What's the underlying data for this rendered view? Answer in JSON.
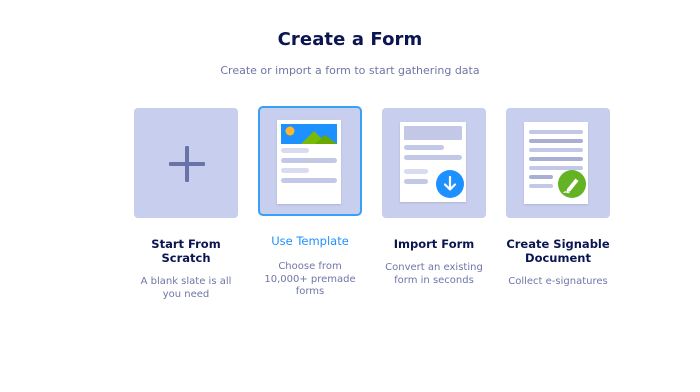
{
  "header": {
    "title": "Create a Form",
    "subtitle": "Create or import a form to start gathering data"
  },
  "options": [
    {
      "label": "Start From Scratch",
      "label_line1": "Start From",
      "label_line2": "Scratch",
      "desc_line1": "A blank slate is all",
      "desc_line2": "you need",
      "icon": "plus-icon"
    },
    {
      "label": "Use Template",
      "desc_line1": "Choose from",
      "desc_line2": "10,000+ premade",
      "desc_line3": "forms",
      "icon": "template-icon",
      "selected": true
    },
    {
      "label": "Import Form",
      "desc_line1": "Convert an existing",
      "desc_line2": "form in seconds",
      "icon": "import-icon"
    },
    {
      "label": "Create Signable Document",
      "label_line1": "Create Signable",
      "label_line2": "Document",
      "desc_line1": "Collect e-signatures",
      "icon": "signature-icon"
    }
  ],
  "colors": {
    "title": "#0a1551",
    "muted": "#6f76a7",
    "tile": "#c8ceed",
    "accent": "#1d91ff",
    "selected_border": "#3aa0f5",
    "import_badge": "#1d91ff",
    "sign_badge": "#64b324"
  }
}
